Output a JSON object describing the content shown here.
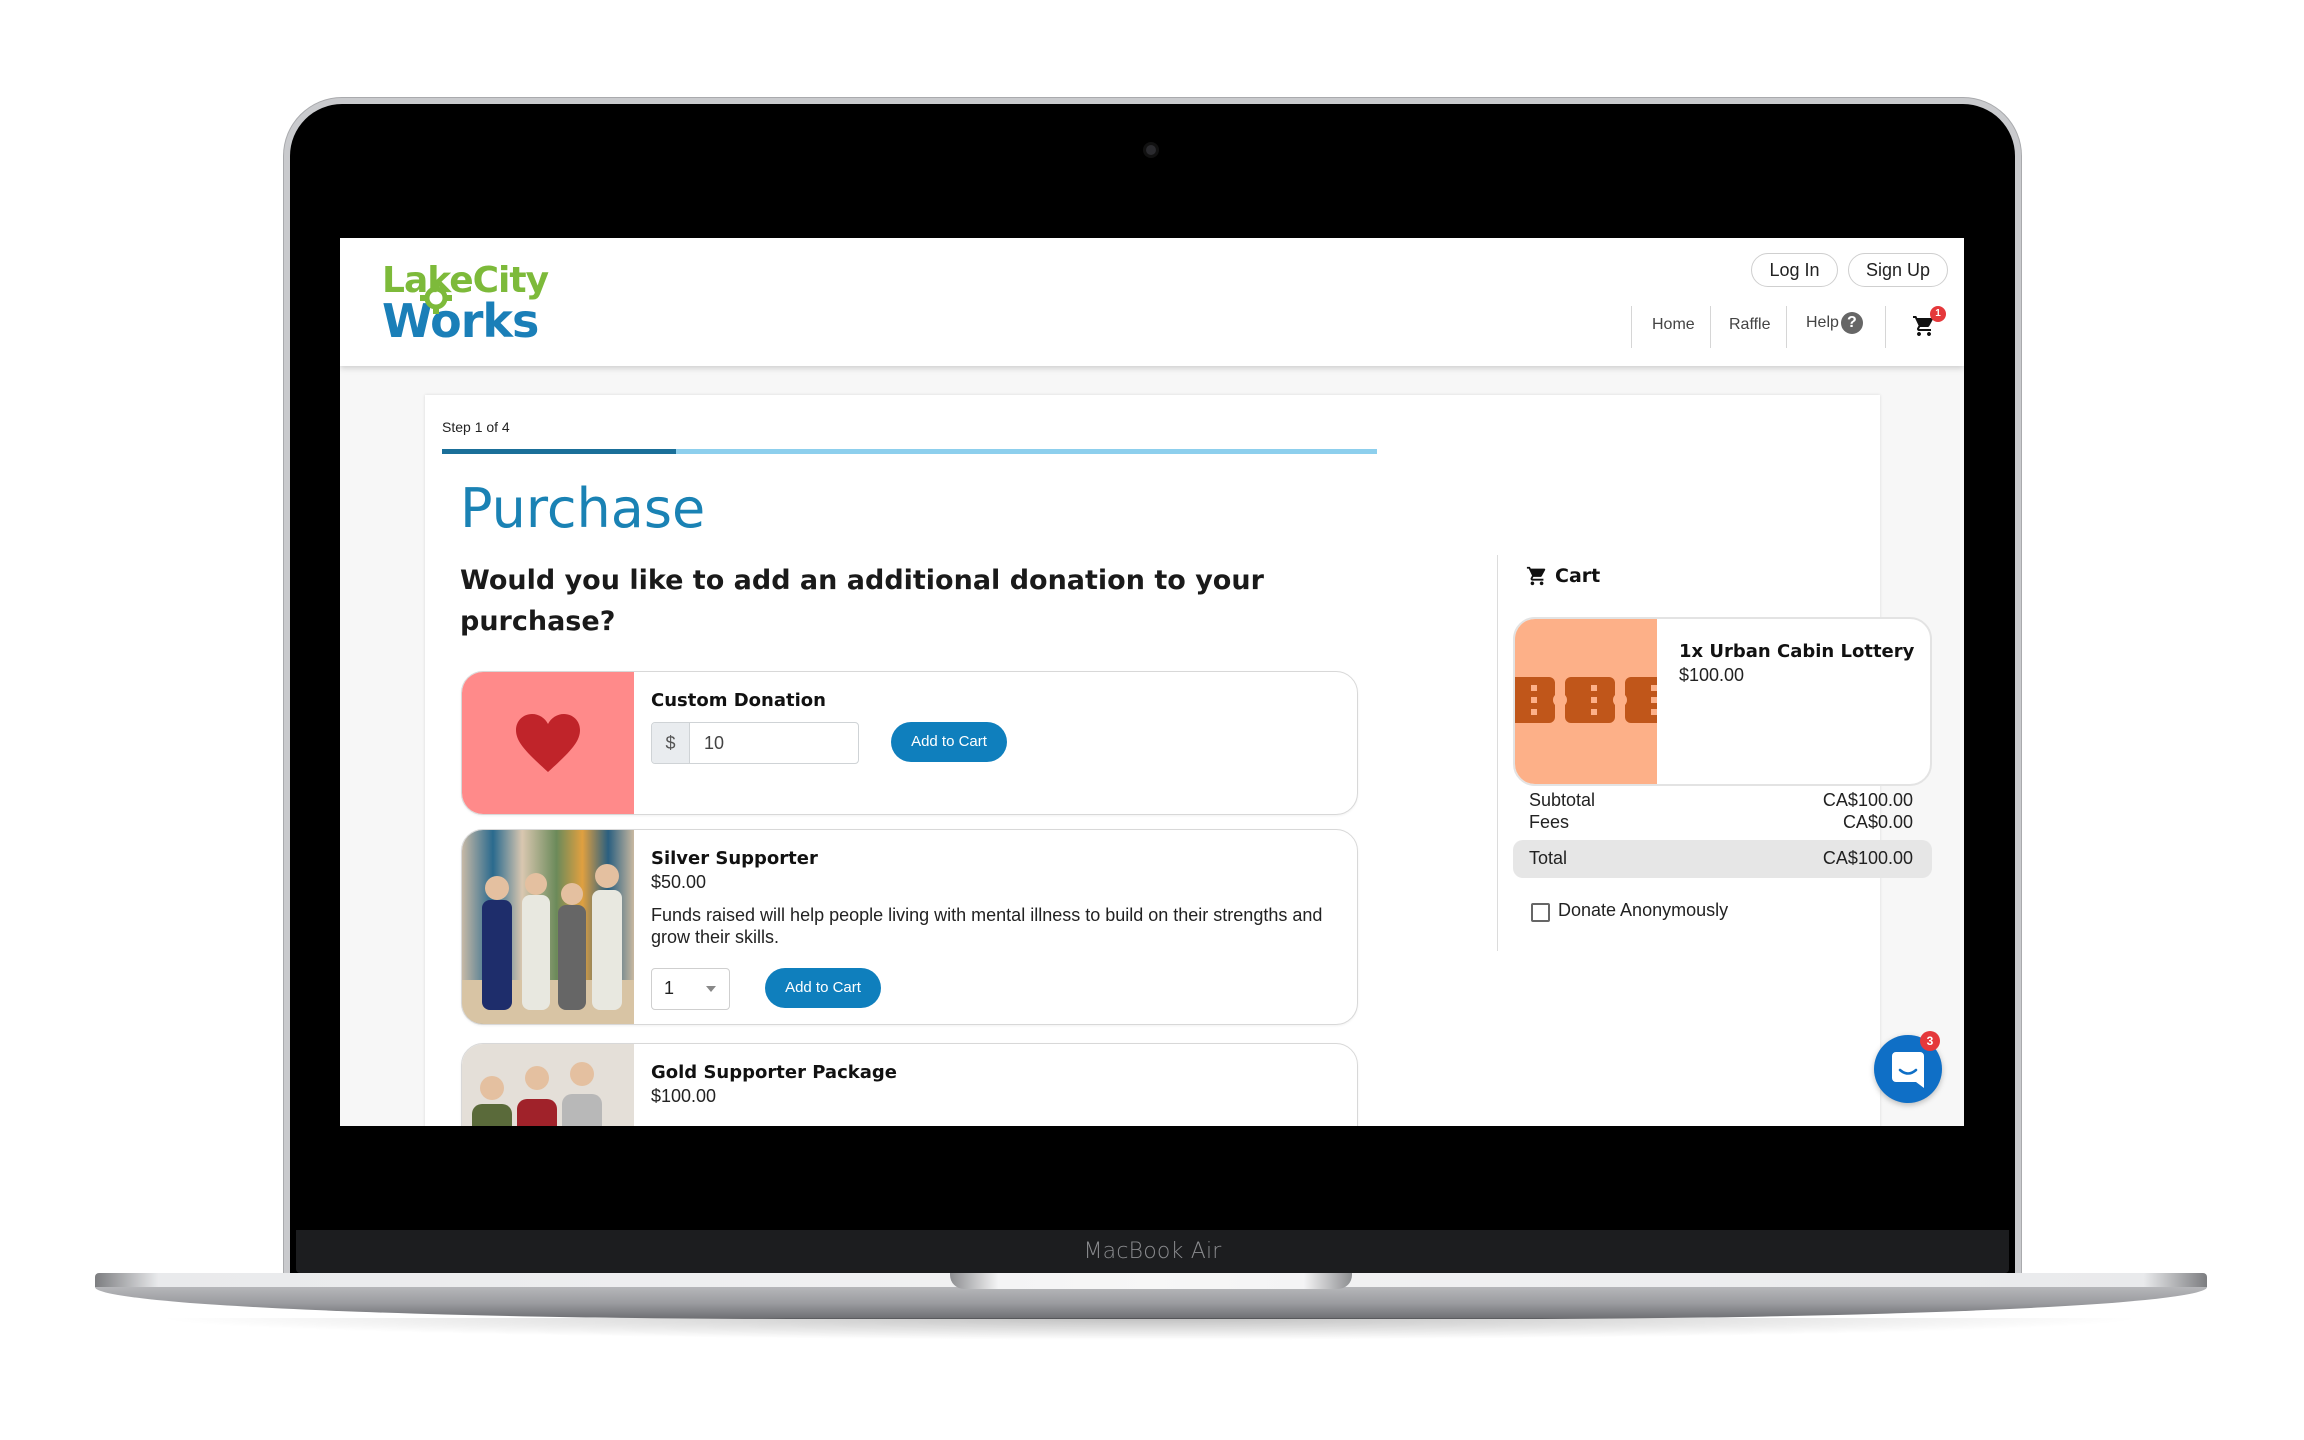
{
  "device": {
    "label": "MacBook Air"
  },
  "header": {
    "logo": {
      "line1": "LakeCity",
      "line2": "Works"
    },
    "auth": {
      "login": "Log In",
      "signup": "Sign Up"
    },
    "nav": [
      {
        "label": "Home"
      },
      {
        "label": "Raffle"
      },
      {
        "label": "Help"
      }
    ],
    "help_icon": "?",
    "cart_badge": "1"
  },
  "wizard": {
    "step_text": "Step 1 of 4",
    "progress_fraction": 0.25,
    "title": "Purchase",
    "question": "Would you like to add an additional donation to your purchase?"
  },
  "products": [
    {
      "name": "Custom Donation",
      "currency_prefix": "$",
      "amount": "10",
      "button": "Add to Cart",
      "image": "heart-icon",
      "image_bg": "#ff8a8a"
    },
    {
      "name": "Silver Supporter",
      "price": "$50.00",
      "description": "Funds raised will help people living with mental illness to build on their strengths and grow their skills.",
      "quantity": "1",
      "button": "Add to Cart",
      "image": "group-photo"
    },
    {
      "name": "Gold Supporter Package",
      "price": "$100.00",
      "image": "group-photo"
    }
  ],
  "cart": {
    "title": "Cart",
    "items": [
      {
        "name": "1x Urban Cabin Lottery",
        "price": "$100.00",
        "image": "ticket-icon"
      }
    ],
    "subtotal_label": "Subtotal",
    "subtotal": "CA$100.00",
    "fees_label": "Fees",
    "fees": "CA$0.00",
    "total_label": "Total",
    "total": "CA$100.00",
    "anonymous_label": "Donate Anonymously",
    "anonymous_checked": false
  },
  "chat": {
    "badge": "3"
  },
  "colors": {
    "brand_blue": "#1a82b4",
    "button_blue": "#0f7fbd",
    "logo_green": "#7dba3a",
    "badge_red": "#e5383b",
    "ticket_bg": "#fdb088",
    "ticket_fg": "#c0561a"
  }
}
